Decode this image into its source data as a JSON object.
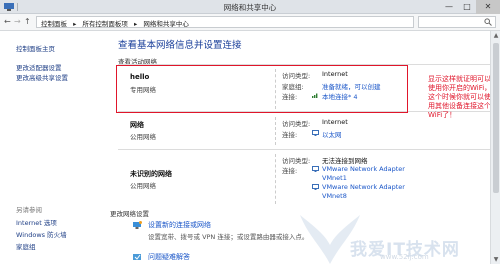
{
  "window": {
    "title": "网络和共享中心",
    "min_glyph": "—",
    "max_glyph": "□",
    "close_glyph": "✕"
  },
  "address": {
    "back": "←",
    "forward": "→",
    "up": "↑",
    "crumbs": [
      "控制面板",
      "▸",
      "所有控制面板项",
      "▸",
      "网络和共享中心"
    ]
  },
  "sidebar": {
    "links": [
      "控制面板主页",
      "更改适配器设置",
      "更改高级共享设置"
    ],
    "see_also_heading": "另请参阅",
    "see_also": [
      "Internet 选项",
      "Windows 防火墙",
      "家庭组"
    ]
  },
  "main": {
    "title": "查看基本网络信息并设置连接",
    "active_networks_label": "查看活动网络",
    "change_settings_label": "更改网络设置",
    "networks": [
      {
        "name": "hello",
        "type": "专用网络",
        "access_label": "访问类型:",
        "access_value": "Internet",
        "homegroup_label": "家庭组:",
        "homegroup_value": "准备就绪，可以创建",
        "connection_label": "连接:",
        "connection_value": "本地连接* 4"
      },
      {
        "name": "网络",
        "type": "公用网络",
        "access_label": "访问类型:",
        "access_value": "Internet",
        "connection_label": "连接:",
        "connection_value": "以太网"
      },
      {
        "name": "未识别的网络",
        "type": "公用网络",
        "access_label": "访问类型:",
        "access_value": "无法连接到网络",
        "connection_label": "连接:",
        "connection_values": [
          "VMware Network Adapter",
          "VMnet1",
          "VMware Network Adapter",
          "VMnet8"
        ]
      }
    ],
    "settings": [
      {
        "link": "设置新的连接或网络",
        "desc": "设置宽带、拨号或 VPN 连接；或设置路由器或接入点。"
      },
      {
        "link": "问题疑难解答"
      }
    ]
  },
  "annotation": "显示这样就证明可以使用你开启的WiFi，这个时候你就可以使用其他设备连接这个WiFi了！",
  "watermark": {
    "text": "我爱IT技术网",
    "url": "www.52ij.com"
  },
  "scrollbar": {
    "up": "▲",
    "down": "▼"
  },
  "colors": {
    "accent_link": "#1a56c8",
    "title_blue": "#1a3f9a",
    "annotation_red": "#e0162b"
  }
}
